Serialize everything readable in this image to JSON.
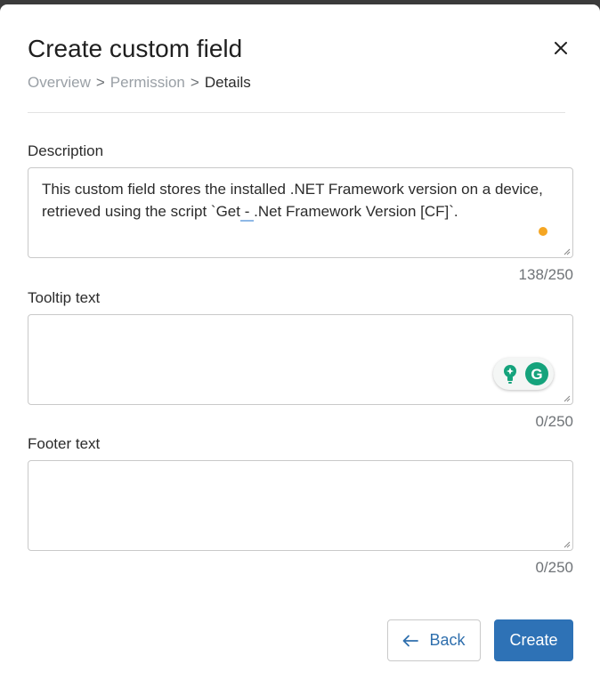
{
  "dialog": {
    "title": "Create custom field",
    "close_icon": "close-icon"
  },
  "breadcrumb": {
    "items": [
      "Overview",
      "Permission",
      "Details"
    ],
    "separator": ">"
  },
  "fields": {
    "description": {
      "label": "Description",
      "value_part1": "This custom field stores the installed .NET Framework version on a device, retrieved using the script `Get",
      "value_part2": " - ",
      "value_part3": ".Net Framework Version [CF]`.",
      "counter": "138/250"
    },
    "tooltip": {
      "label": "Tooltip text",
      "value": "",
      "counter": "0/250"
    },
    "footer": {
      "label": "Footer text",
      "value": "",
      "counter": "0/250"
    }
  },
  "grammarly": {
    "icons": [
      "lightbulb-icon",
      "grammarly-logo-icon"
    ],
    "logo_letter": "G"
  },
  "actions": {
    "back_label": "Back",
    "create_label": "Create"
  },
  "colors": {
    "primary": "#2e72b6",
    "muted_text": "#9aa0a6",
    "indicator": "#f5a623",
    "grammarly_green": "#15a37c"
  }
}
